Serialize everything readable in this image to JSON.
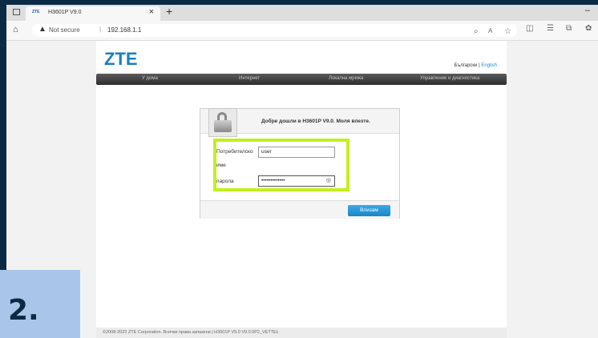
{
  "browser": {
    "tab_title": "H3601P V9.0",
    "tab_favicon": "ZTE",
    "new_tab_symbol": "+",
    "tab_close": "×",
    "minimize": "–",
    "security_label": "Not secure",
    "url": "192.168.1.1"
  },
  "header": {
    "logo": "ZTE",
    "lang_current": "Български",
    "lang_separator": "|",
    "lang_other": "English"
  },
  "nav": {
    "items": [
      "У дома",
      "Интернет",
      "Локална мрежа",
      "Управление и диагностика"
    ]
  },
  "login": {
    "welcome": "Добре дошли в H3601P V9.0. Моля влезте.",
    "username_label": "Потребителско",
    "username_label2": "име",
    "username_value": "user",
    "password_label": "парола",
    "password_value": "•••••••••••••",
    "submit_label": "Влизам"
  },
  "footer": {
    "text": "©2008-2022 ZTE Corporation. Всички права запазени  |  H3601P V9.0 V9.0.0P2_VETTEL"
  },
  "overlay": {
    "step_number": "2.",
    "highlight_color": "#c3f01f"
  },
  "colors": {
    "accent": "#1a7fc1",
    "button": "#1a86c9"
  }
}
